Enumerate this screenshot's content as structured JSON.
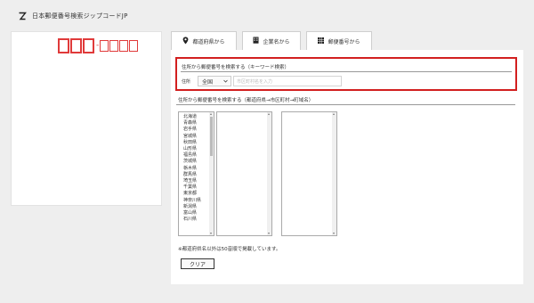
{
  "app": {
    "title": "日本郵便番号検索ジップコードJP"
  },
  "tabs": [
    {
      "label": "都道府県から",
      "icon": "map-pin-icon"
    },
    {
      "label": "企業名から",
      "icon": "building-icon"
    },
    {
      "label": "郵便番号から",
      "icon": "grid-icon"
    }
  ],
  "keyword_search": {
    "heading": "住所から郵便番号を検索する（キーワード検索）",
    "label": "住所",
    "prefecture_select": "全国",
    "placeholder": "市区町村名を入力"
  },
  "region_search": {
    "heading": "住所から郵便番号を検索する（都道府県→市区町村→町域名）",
    "prefectures": [
      "北海道",
      "青森県",
      "岩手県",
      "宮城県",
      "秋田県",
      "山形県",
      "福島県",
      "茨城県",
      "栃木県",
      "群馬県",
      "埼玉県",
      "千葉県",
      "東京都",
      "神奈川県",
      "新潟県",
      "富山県",
      "石川県"
    ]
  },
  "note": "※都道府県名以外は50音順で掲載しています。",
  "clear_button": "クリア",
  "colors": {
    "accent_red": "#d21f1f",
    "zip_red": "#e03a3a"
  }
}
